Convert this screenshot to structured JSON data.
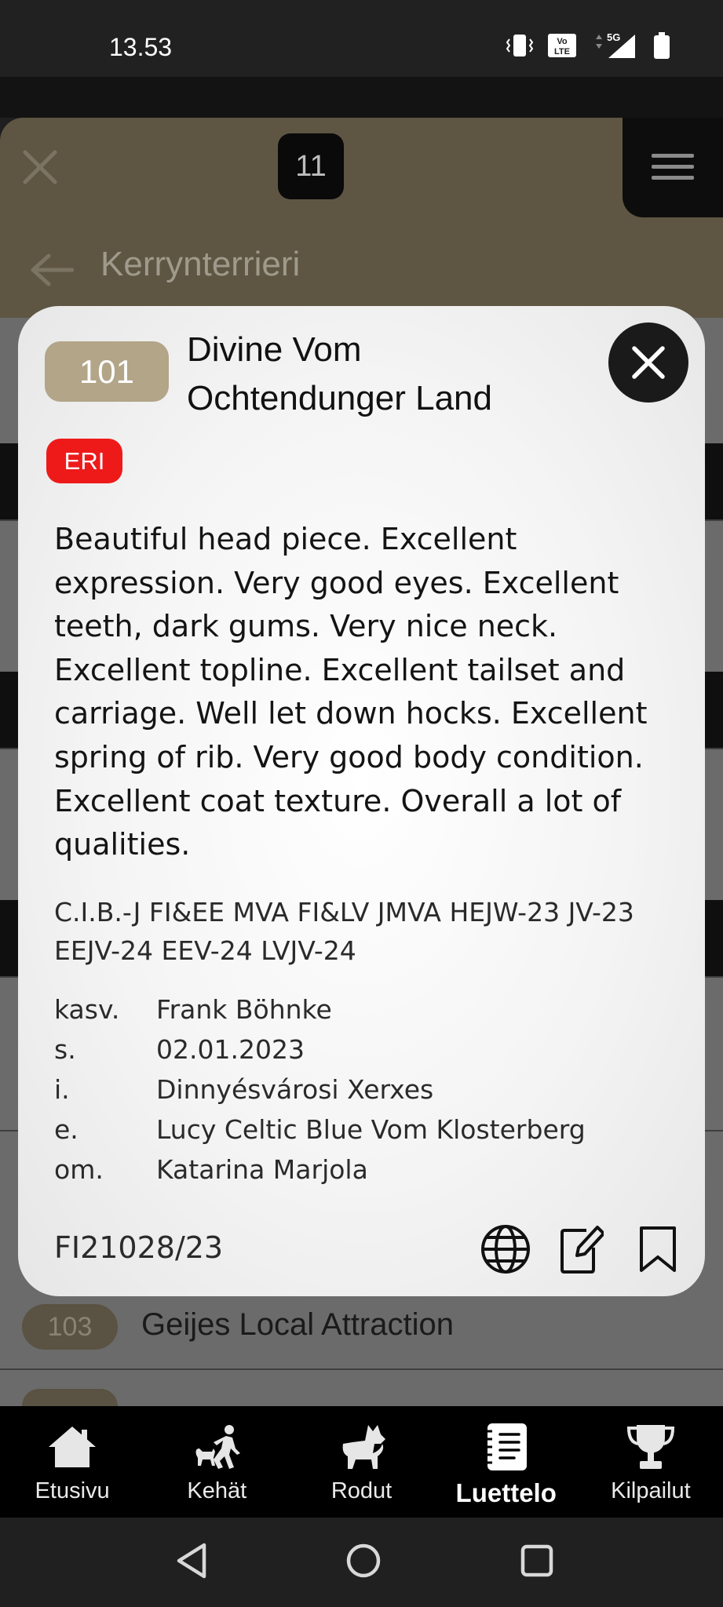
{
  "status_bar": {
    "time": "13.53",
    "network": "5G"
  },
  "header": {
    "ring_number": "11",
    "breed": "Kerrynterrieri"
  },
  "background_list": [
    {
      "number": "103",
      "name": "Geijes Local Attraction"
    }
  ],
  "dog_card": {
    "catalog_number": "101",
    "name": "Divine Vom Ochtendunger Land",
    "award": "ERI",
    "award_color": "#ee1a1a",
    "badge_color": "#b2a588",
    "critique": "Beautiful head piece. Excellent expression. Very good eyes. Excellent teeth, dark gums. Very nice neck. Excellent topline. Excellent tailset and carriage. Well let down hocks. Excellent spring of rib. Very good body condition. Excellent coat texture. Overall a lot of qualities.",
    "titles": "C.I.B.-J FI&EE MVA FI&LV JMVA HEJW-23 JV-23 EEJV-24 EEV-24 LVJV-24",
    "info": [
      {
        "key": "kasv.",
        "value": "Frank Böhnke"
      },
      {
        "key": "s.",
        "value": "02.01.2023"
      },
      {
        "key": "i.",
        "value": "Dinnyésvárosi Xerxes"
      },
      {
        "key": "e.",
        "value": "Lucy Celtic Blue Vom Klosterberg"
      },
      {
        "key": "om.",
        "value": "Katarina Marjola"
      }
    ],
    "registration_number": "FI21028/23",
    "actions": [
      "globe-icon",
      "edit-note-icon",
      "bookmark-icon"
    ]
  },
  "bottom_nav": {
    "active": "Luettelo",
    "items": [
      {
        "label": "Etusivu",
        "icon": "home-icon"
      },
      {
        "label": "Kehät",
        "icon": "handler-dog-icon"
      },
      {
        "label": "Rodut",
        "icon": "dog-icon"
      },
      {
        "label": "Luettelo",
        "icon": "catalog-icon"
      },
      {
        "label": "Kilpailut",
        "icon": "trophy-icon"
      }
    ]
  }
}
